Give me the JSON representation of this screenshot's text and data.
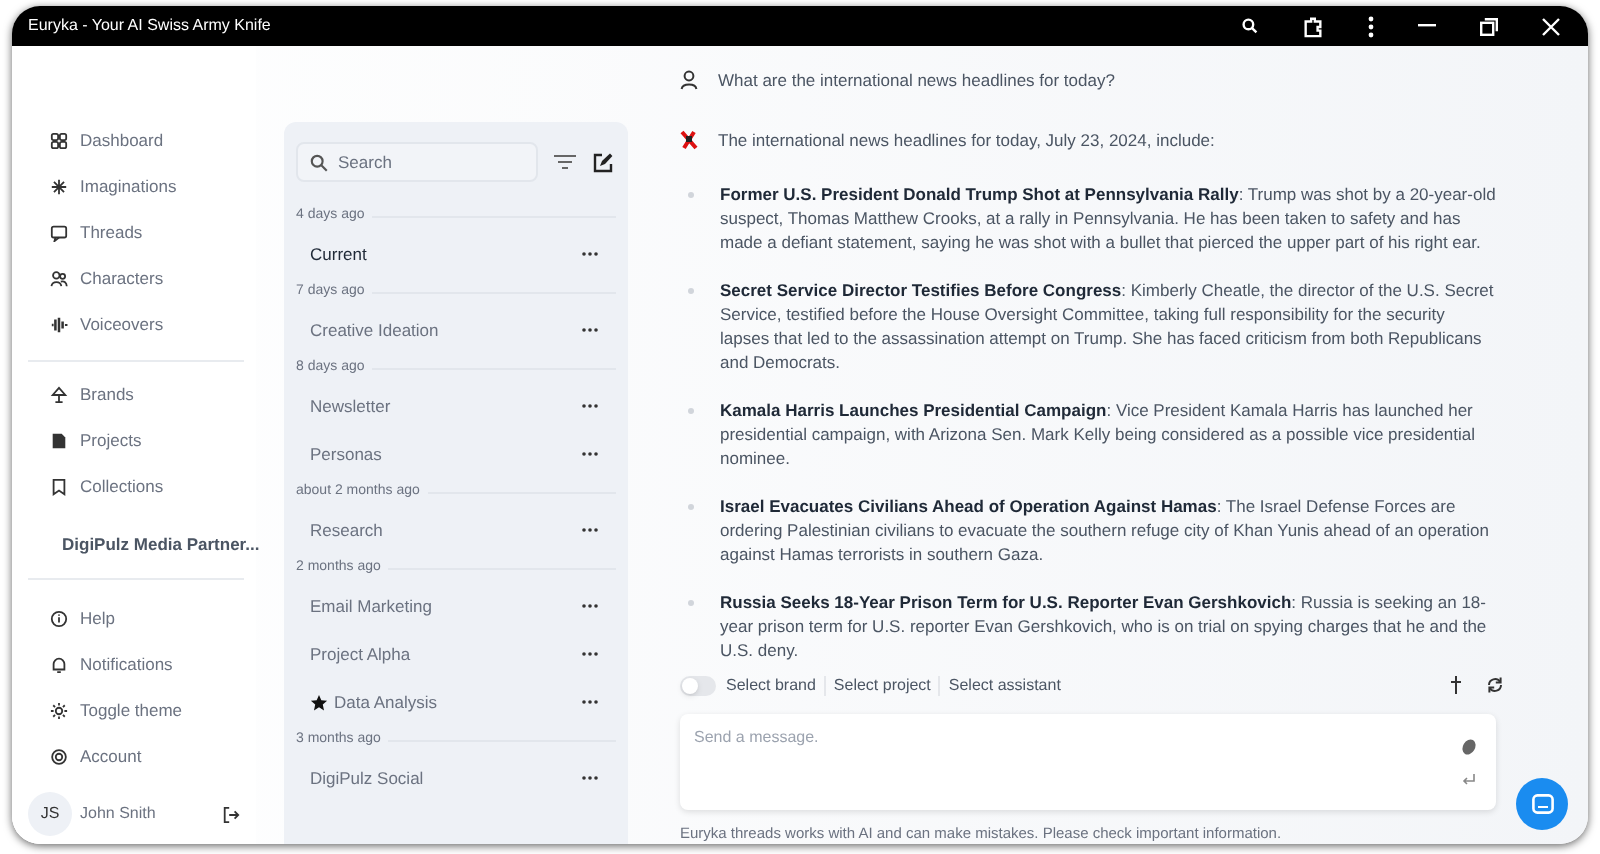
{
  "window": {
    "title": "Euryka - Your AI Swiss Army Knife"
  },
  "sidebar": {
    "groups": [
      {
        "items": [
          {
            "label": "Dashboard"
          },
          {
            "label": "Imaginations"
          },
          {
            "label": "Threads"
          },
          {
            "label": "Characters"
          },
          {
            "label": "Voiceovers"
          }
        ]
      },
      {
        "items": [
          {
            "label": "Brands"
          },
          {
            "label": "Projects"
          },
          {
            "label": "Collections"
          }
        ]
      }
    ],
    "workspace": "DigiPulz Media Partner...",
    "bottom_items": [
      {
        "label": "Help"
      },
      {
        "label": "Notifications"
      },
      {
        "label": "Toggle theme"
      },
      {
        "label": "Account"
      }
    ],
    "user": {
      "initials": "JS",
      "name": "John Snith"
    }
  },
  "threads": {
    "search": {
      "placeholder": "Search"
    },
    "groups": [
      {
        "label": "4 days ago",
        "items": [
          {
            "title": "Current",
            "selected": true,
            "starred": false
          }
        ]
      },
      {
        "label": "7 days ago",
        "items": [
          {
            "title": "Creative Ideation",
            "selected": false,
            "starred": false
          }
        ]
      },
      {
        "label": "8 days ago",
        "items": [
          {
            "title": "Newsletter",
            "selected": false,
            "starred": false
          },
          {
            "title": "Personas",
            "selected": false,
            "starred": false
          }
        ]
      },
      {
        "label": "about 2 months ago",
        "items": [
          {
            "title": "Research",
            "selected": false,
            "starred": false
          }
        ]
      },
      {
        "label": "2 months ago",
        "items": [
          {
            "title": "Email Marketing",
            "selected": false,
            "starred": false
          },
          {
            "title": "Project Alpha",
            "selected": false,
            "starred": false
          },
          {
            "title": "Data Analysis",
            "selected": false,
            "starred": true
          }
        ]
      },
      {
        "label": "3 months ago",
        "items": [
          {
            "title": "DigiPulz Social",
            "selected": false,
            "starred": false
          }
        ]
      }
    ]
  },
  "chat": {
    "user_message": "What are the international news headlines for today?",
    "assistant": {
      "intro": "The international news headlines for today, July 23, 2024, include:",
      "bullets": [
        "**Former U.S. President Donald Trump Shot at Pennsylvania Rally**: Trump was shot by a 20-year-old suspect, Thomas Matthew Crooks, at a rally in Pennsylvania. He has been taken to safety and has made a defiant statement, saying he was shot with a bullet that pierced the upper part of his right ear.",
        "**Secret Service Director Testifies Before Congress**: Kimberly Cheatle, the director of the U.S. Secret Service, testified before the House Oversight Committee, taking full responsibility for the security lapses that led to the assassination attempt on Trump. She has faced criticism from both Republicans and Democrats.",
        "**Kamala Harris Launches Presidential Campaign**: Vice President Kamala Harris has launched her presidential campaign, with Arizona Sen. Mark Kelly being considered as a possible vice presidential nominee.",
        "**Israel Evacuates Civilians Ahead of Operation Against Hamas**: The Israel Defense Forces are ordering Palestinian civilians to evacuate the southern refuge city of Khan Yunis ahead of an operation against Hamas terrorists in southern Gaza.",
        "**Russia Seeks 18-Year Prison Term for U.S. Reporter Evan Gershkovich**: Russia is seeking an 18-year prison term for U.S. reporter Evan Gershkovich, who is on trial on spying charges that he and the U.S. deny."
      ]
    }
  },
  "composer": {
    "toggle": {
      "on": false
    },
    "selectors": [
      "Select brand",
      "Select project",
      "Select assistant"
    ],
    "placeholder": "Send a message.",
    "disclaimer": "Euryka threads works with AI and can make mistakes. Please check important information."
  }
}
